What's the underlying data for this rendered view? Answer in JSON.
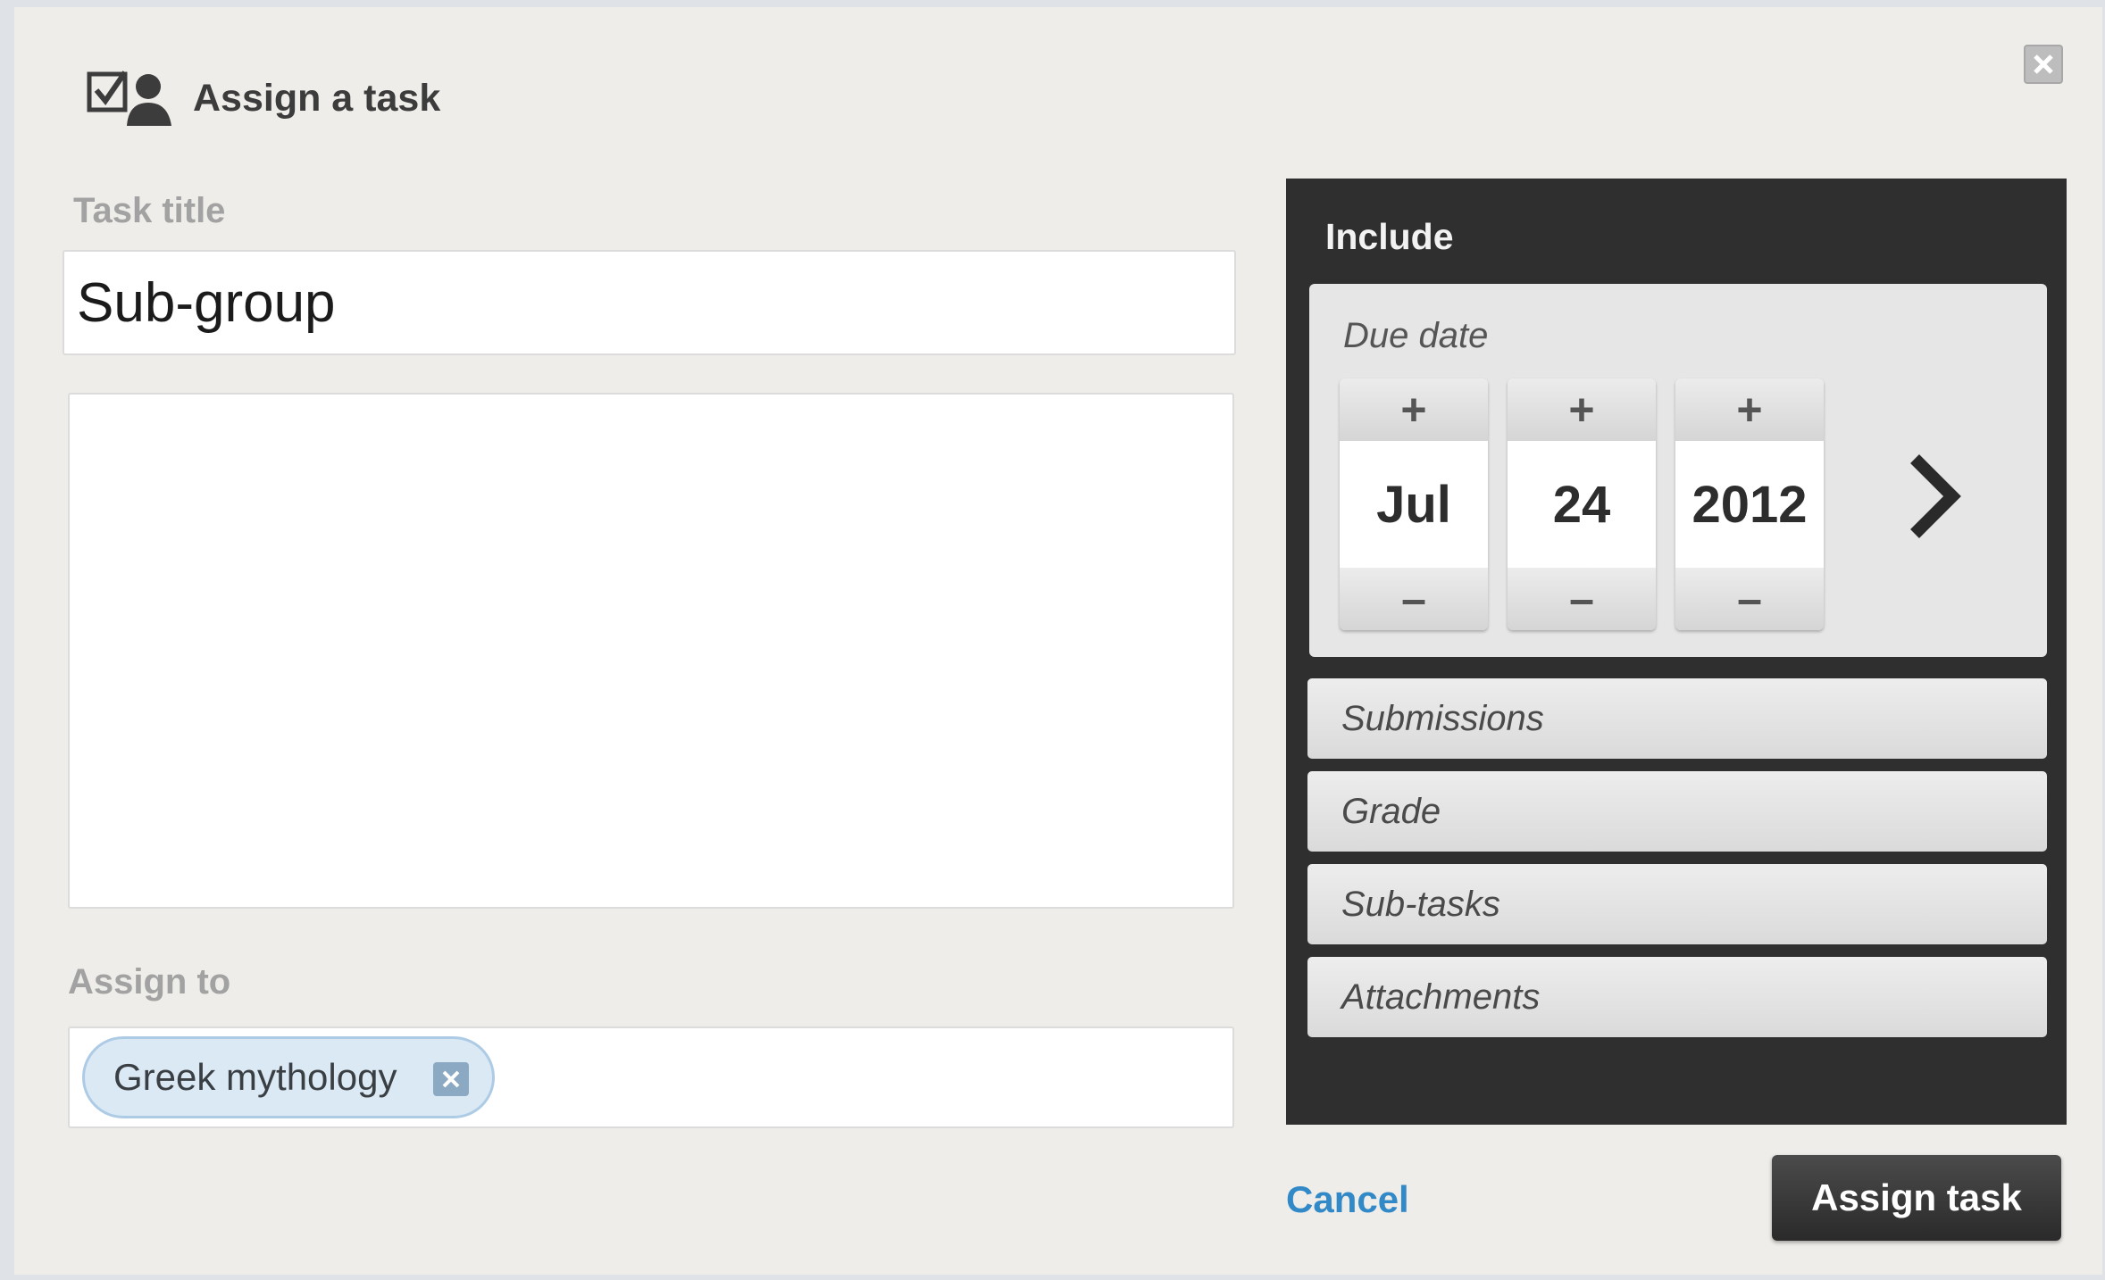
{
  "dialog": {
    "title": "Assign a task",
    "header_icon": "checkbox-person-icon",
    "close_icon": "close-icon"
  },
  "form": {
    "task_title_label": "Task title",
    "task_title_value": "Sub-group",
    "description_value": "",
    "assign_to_label": "Assign to",
    "assignee_tag": "Greek mythology",
    "assignee_remove_icon": "remove-tag-icon"
  },
  "include": {
    "title": "Include",
    "due_date": {
      "label": "Due date",
      "month": "Jul",
      "day": "24",
      "year": "2012",
      "increment_symbol": "+",
      "decrement_symbol": "–",
      "next_icon": "chevron-right-icon"
    },
    "options": [
      "Submissions",
      "Grade",
      "Sub-tasks",
      "Attachments"
    ]
  },
  "actions": {
    "cancel_label": "Cancel",
    "assign_label": "Assign task"
  },
  "colors": {
    "dialog_bg": "#efede9",
    "panel_bg": "#2f2f2f",
    "link": "#3189c7",
    "tag_bg": "#dbe9f5"
  }
}
